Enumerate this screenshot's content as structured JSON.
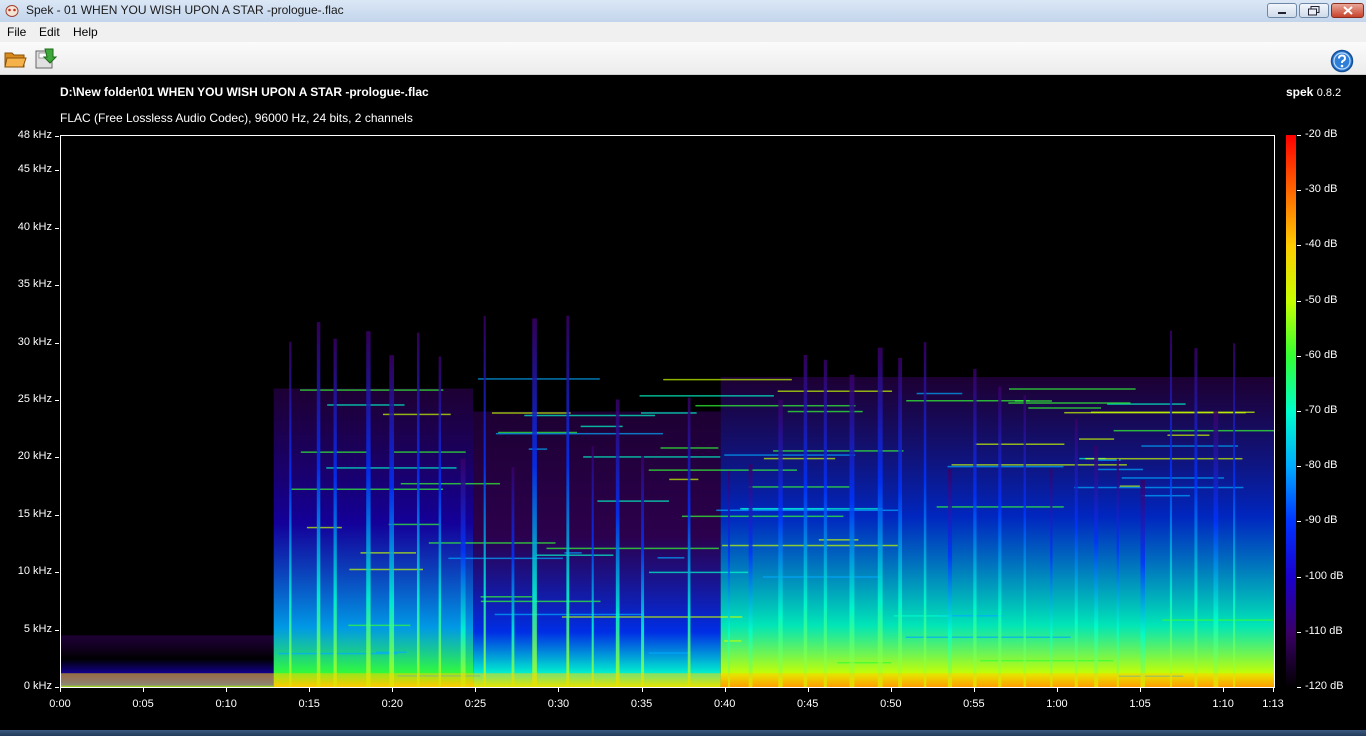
{
  "window": {
    "title": "Spek - 01 WHEN YOU WISH UPON A STAR -prologue-.flac",
    "icon": "spek-app-icon",
    "controls": [
      "minimize-icon",
      "maximize-icon",
      "close-icon"
    ]
  },
  "menu": {
    "file": "File",
    "edit": "Edit",
    "help": "Help"
  },
  "toolbar": {
    "open_icon": "folder-open-icon",
    "save_icon": "save-icon",
    "help_icon": "help-icon"
  },
  "viewer": {
    "file_path": "D:\\New folder\\01 WHEN YOU WISH UPON A STAR -prologue-.flac",
    "file_info": "FLAC (Free Lossless Audio Codec), 96000 Hz, 24 bits, 2 channels",
    "brand_name": "spek",
    "brand_version": "0.8.2"
  },
  "chart_data": {
    "type": "heatmap",
    "x_axis": {
      "unit": "time",
      "range_seconds": [
        0,
        73
      ],
      "ticks": [
        "0:00",
        "0:05",
        "0:10",
        "0:15",
        "0:20",
        "0:25",
        "0:30",
        "0:35",
        "0:40",
        "0:45",
        "0:50",
        "0:55",
        "1:00",
        "1:05",
        "1:10",
        "1:13"
      ],
      "tick_seconds": [
        0,
        5,
        10,
        15,
        20,
        25,
        30,
        35,
        40,
        45,
        50,
        55,
        60,
        65,
        70,
        73
      ]
    },
    "y_axis": {
      "unit": "kHz",
      "range": [
        0,
        48
      ],
      "ticks": [
        "0 kHz",
        "5 kHz",
        "10 kHz",
        "15 kHz",
        "20 kHz",
        "25 kHz",
        "30 kHz",
        "35 kHz",
        "40 kHz",
        "45 kHz",
        "48 kHz"
      ],
      "tick_values": [
        0,
        5,
        10,
        15,
        20,
        25,
        30,
        35,
        40,
        45,
        48
      ]
    },
    "color_scale": {
      "unit": "dB",
      "range": [
        -120,
        -20
      ],
      "ticks": [
        "-20 dB",
        "-30 dB",
        "-40 dB",
        "-50 dB",
        "-60 dB",
        "-70 dB",
        "-80 dB",
        "-90 dB",
        "-100 dB",
        "-110 dB",
        "-120 dB"
      ],
      "tick_values": [
        -20,
        -30,
        -40,
        -50,
        -60,
        -70,
        -80,
        -90,
        -100,
        -110,
        -120
      ],
      "colors": [
        "#ff0000",
        "#ff6600",
        "#ffcc00",
        "#c8ff00",
        "#33ff33",
        "#00ffcc",
        "#00aaff",
        "#0033ff",
        "#1a00cc",
        "#3a0066",
        "#000000"
      ]
    },
    "segments": [
      {
        "start": 0,
        "end": 12.8,
        "top_khz": 4.5,
        "level": 0.35
      },
      {
        "start": 12.8,
        "end": 24.8,
        "top_khz": 26,
        "level": 0.6
      },
      {
        "start": 24.8,
        "end": 39.7,
        "top_khz": 24,
        "level": 0.5
      },
      {
        "start": 39.7,
        "end": 73,
        "top_khz": 27,
        "level": 0.7
      }
    ],
    "transients_seconds": [
      13.8,
      15.5,
      16.5,
      18.5,
      19.9,
      21.5,
      22.8,
      24.2,
      25.5,
      27.2,
      28.5,
      30.5,
      32.0,
      33.5,
      35.0,
      37.8,
      40.2,
      41.5,
      43.3,
      44.8,
      46.0,
      47.6,
      49.3,
      50.5,
      52.0,
      53.5,
      55.0,
      56.5,
      58.0,
      59.6,
      61.1,
      62.3,
      63.6,
      65.1,
      66.8,
      68.3,
      69.5,
      70.6
    ]
  }
}
